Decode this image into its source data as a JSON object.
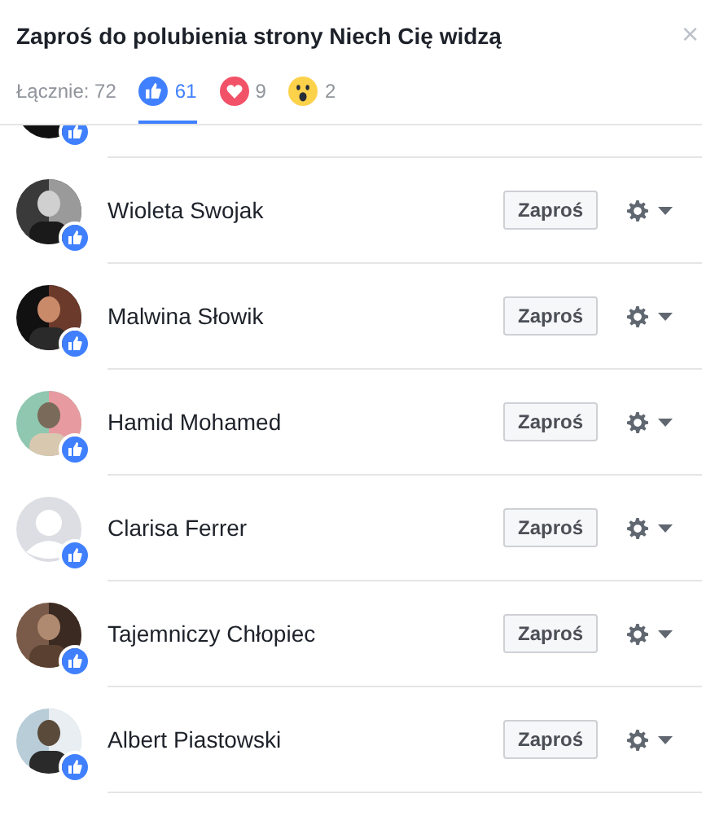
{
  "dialog": {
    "title": "Zaproś do polubienia strony Niech Cię widzą",
    "close": "×"
  },
  "tabs": [
    {
      "kind": "all",
      "label": "Łącznie: 72",
      "selected": false
    },
    {
      "kind": "like",
      "label": "61",
      "selected": true
    },
    {
      "kind": "love",
      "label": "9",
      "selected": false
    },
    {
      "kind": "wow",
      "label": "2",
      "selected": false
    }
  ],
  "people": [
    {
      "name": "Wioleta Swojak",
      "kind": "picture",
      "button": "Zaproś"
    },
    {
      "name": "Malwina Słowik",
      "kind": "picture",
      "button": "Zaproś"
    },
    {
      "name": "Hamid Mohamed",
      "kind": "picture",
      "button": "Zaproś"
    },
    {
      "name": "Clarisa Ferrer",
      "kind": "default",
      "button": "Zaproś"
    },
    {
      "name": "Tajemniczy Chłopiec",
      "kind": "picture",
      "button": "Zaproś"
    },
    {
      "name": "Albert Piastowski",
      "kind": "picture",
      "button": "Zaproś"
    }
  ]
}
